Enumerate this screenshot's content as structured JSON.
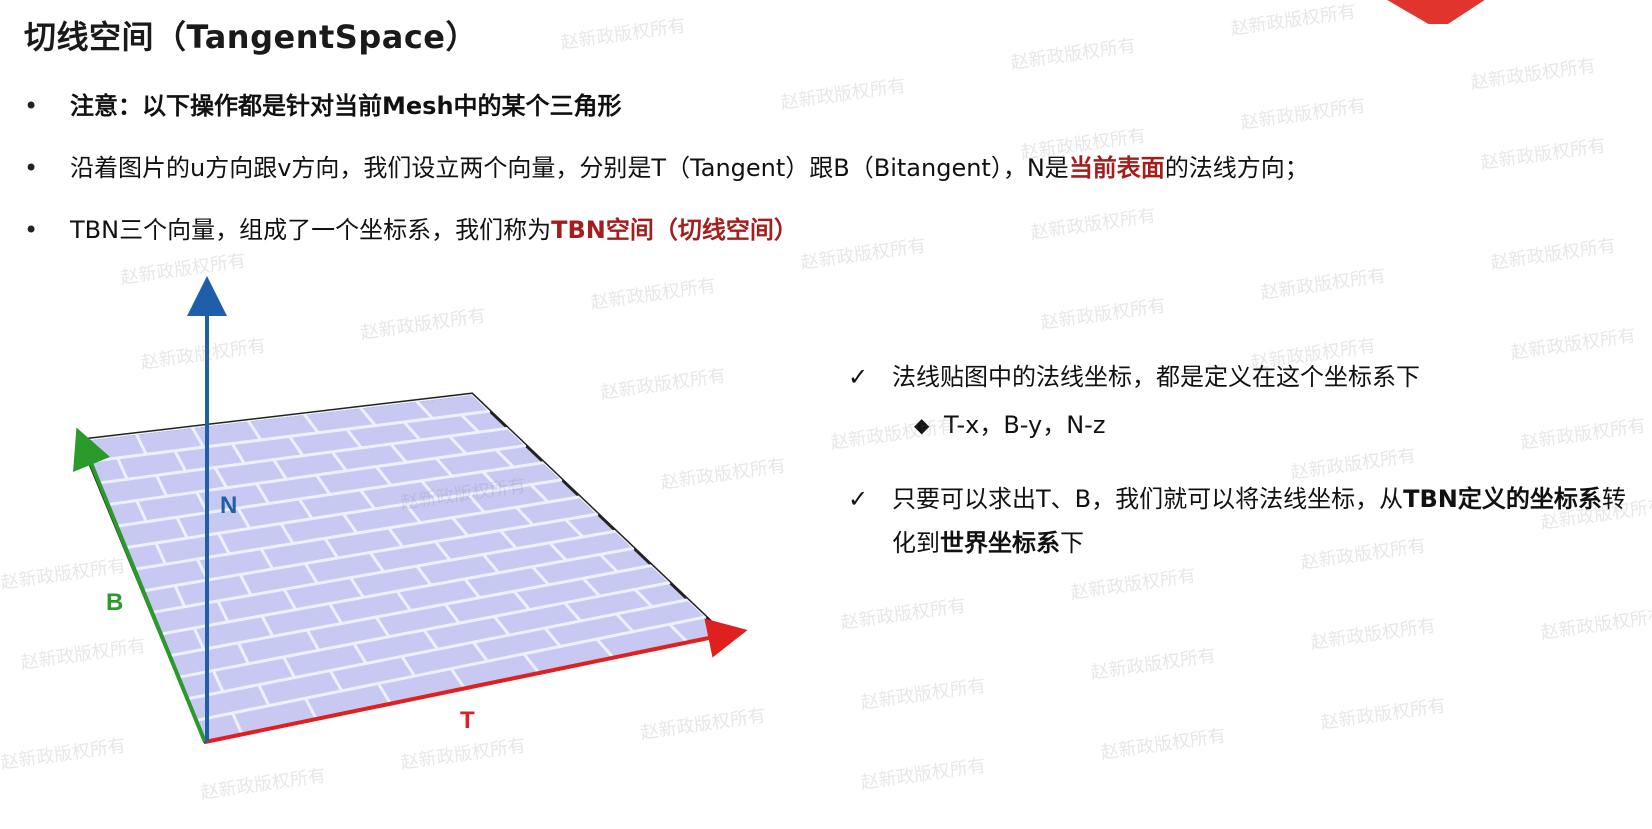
{
  "title": "切线空间（TangentSpace）",
  "bullet_marker": "•",
  "bullets": [
    {
      "text": "注意：以下操作都是针对当前Mesh中的某个三角形"
    },
    {
      "pre": "沿着图片的u方向跟v方向，我们设立两个向量，分别是T（Tangent）跟B（Bitangent），N是",
      "highlight": "当前表面",
      "post": "的法线方向；"
    },
    {
      "pre": "TBN三个向量，组成了一个坐标系，我们称为",
      "highlight": "TBN空间（切线空间）"
    }
  ],
  "diagram": {
    "labels": {
      "n": "N",
      "b": "B",
      "t": "T"
    },
    "colors": {
      "n": "#1f5fa8",
      "b": "#2a9a2a",
      "t": "#e02020",
      "surface": "#c7c9f3",
      "brick_line": "#eef0ff"
    }
  },
  "right_panel": {
    "check_mark": "✓",
    "diamond_mark": "◆",
    "item1": "法线贴图中的法线坐标，都是定义在这个坐标系下",
    "sub": "T-x，B-y，N-z",
    "item2_part1": "只要可以求出T、B，我们就可以将法线坐标，从",
    "item2_bold1": "TBN定义的坐标系",
    "item2_part2": "转化到",
    "item2_bold2": "世界坐标系",
    "item2_part3": "下"
  },
  "watermark_text": "赵新政版权所有"
}
